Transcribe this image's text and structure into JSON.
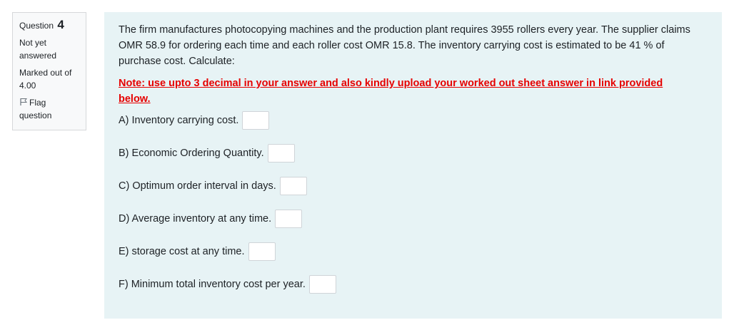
{
  "question_info": {
    "label": "Question",
    "number": "4",
    "state_line1": "Not yet",
    "state_line2": "answered",
    "grade_line1": "Marked out of",
    "grade_line2": "4.00",
    "flag_line1": "Flag",
    "flag_line2": "question"
  },
  "question": {
    "text": "The firm manufactures photocopying machines and the production plant requires 3955 rollers every year. The supplier claims OMR 58.9 for ordering each time and each roller cost OMR 15.8. The inventory carrying cost is estimated to be  41 % of purchase cost. Calculate:",
    "note": "Note: use upto 3 decimal in your answer and also kindly upload your worked out sheet answer in link provided below.",
    "parts": [
      {
        "label": "A) Inventory carrying cost.",
        "value": ""
      },
      {
        "label": "B) Economic Ordering Quantity.",
        "value": ""
      },
      {
        "label": "C) Optimum order interval in days.",
        "value": ""
      },
      {
        "label": "D) Average inventory at any time.",
        "value": ""
      },
      {
        "label": "E) storage cost at any time.",
        "value": ""
      },
      {
        "label": "F) Minimum total inventory cost per year.",
        "value": ""
      }
    ]
  },
  "colors": {
    "content_bg": "#e7f3f5",
    "info_bg": "#f8f9fa",
    "note_red": "#e60000"
  }
}
